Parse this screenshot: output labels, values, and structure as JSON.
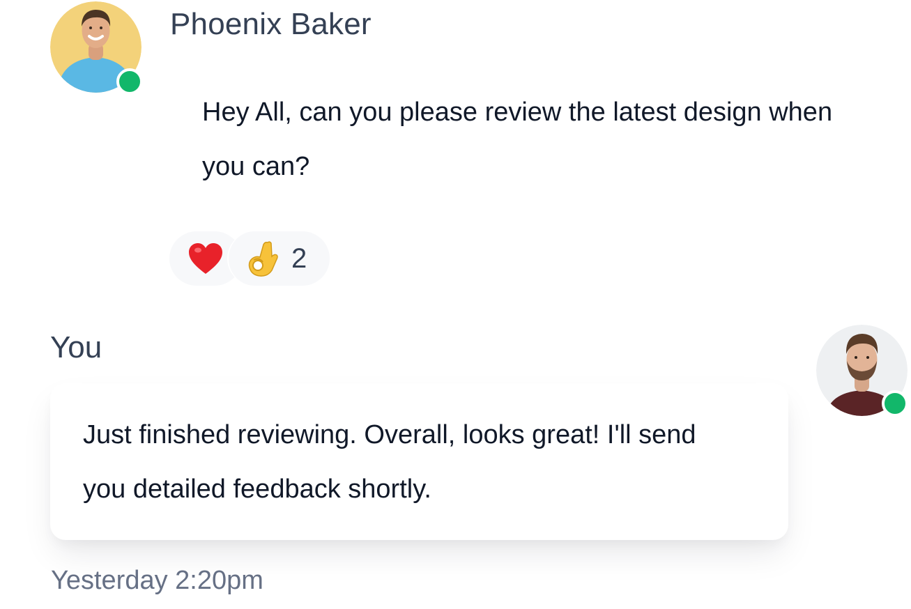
{
  "colors": {
    "online": "#12b76a",
    "name_text": "#344054",
    "body_text": "#101828",
    "meta_text": "#667085",
    "reaction_bg": "#f7f8fa"
  },
  "incoming": {
    "sender_name": "Phoenix Baker",
    "message": "Hey All, can you please review the latest design when you can?",
    "online": true,
    "reactions": [
      {
        "icon": "heart-icon",
        "count": ""
      },
      {
        "icon": "ok-hand-icon",
        "count": "2"
      }
    ]
  },
  "outgoing": {
    "sender_label": "You",
    "message": "Just finished reviewing. Overall, looks great! I'll send you detailed feedback shortly.",
    "timestamp": "Yesterday 2:20pm",
    "online": true
  }
}
